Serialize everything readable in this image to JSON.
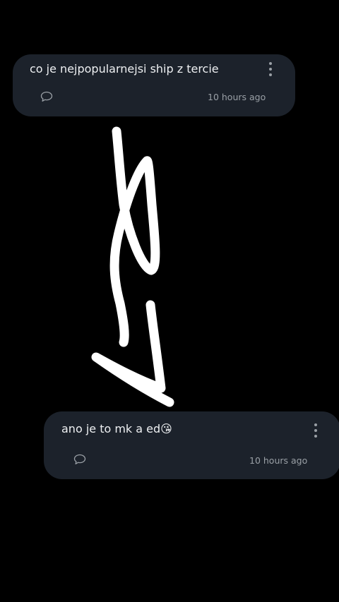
{
  "posts": [
    {
      "text": "co je nejpopularnejsi ship z tercie",
      "time": "10 hours ago",
      "icons": {
        "menu": "more-vertical-icon",
        "comment": "comment-icon"
      }
    },
    {
      "text": "ano je to mk a ed",
      "emoji": "😘",
      "time": "10 hours ago",
      "icons": {
        "menu": "more-vertical-icon",
        "comment": "comment-icon"
      }
    }
  ],
  "overlay": {
    "type": "freehand-drawing",
    "color": "#ffffff"
  }
}
